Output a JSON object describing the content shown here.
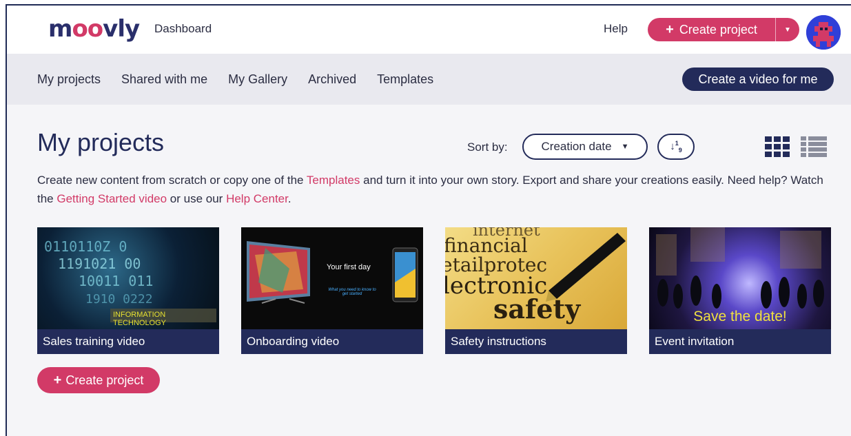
{
  "header": {
    "logo_text": "moovly",
    "dashboard_link": "Dashboard",
    "help_link": "Help",
    "create_project": "Create project"
  },
  "subnav": {
    "tabs": [
      "My projects",
      "Shared with me",
      "My Gallery",
      "Archived",
      "Templates"
    ],
    "video_button": "Create a video for me"
  },
  "main": {
    "title": "My projects",
    "sort_label": "Sort by:",
    "sort_value": "Creation date",
    "desc_1": "Create new content from scratch or copy one of the ",
    "desc_link_templates": "Templates",
    "desc_2": " and turn it into your own story. Export and share your creations easily. Need help? Watch the ",
    "desc_link_video": "Getting Started video",
    "desc_3": " or use our ",
    "desc_link_help": "Help Center",
    "desc_4": ".",
    "create_project": "Create project"
  },
  "projects": [
    {
      "title": "Sales training video",
      "thumb_label": "INFORMATION TECHNOLOGY"
    },
    {
      "title": "Onboarding video",
      "thumb_title": "Your first day",
      "thumb_sub": "What you need to know to get started"
    },
    {
      "title": "Safety instructions"
    },
    {
      "title": "Event invitation",
      "thumb_label": "Save the date!"
    }
  ],
  "colors": {
    "accent": "#d23a67",
    "navy": "#232b5a",
    "subnav_bg": "#e9e9ef"
  }
}
